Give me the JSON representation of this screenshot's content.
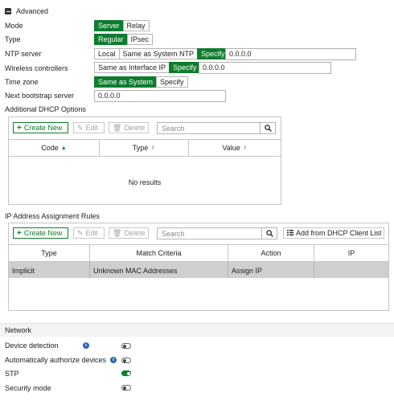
{
  "advanced": {
    "toggle_icon": "minus-square-icon",
    "title": "Advanced",
    "mode": {
      "label": "Mode",
      "options": [
        "Server",
        "Relay"
      ],
      "selected": "Server"
    },
    "type": {
      "label": "Type",
      "options": [
        "Regular",
        "IPsec"
      ],
      "selected": "Regular"
    },
    "ntp": {
      "label": "NTP server",
      "options": [
        "Local",
        "Same as System NTP",
        "Specify"
      ],
      "selected": "Specify",
      "value": "0.0.0.0"
    },
    "wlc": {
      "label": "Wireless controllers",
      "options": [
        "Same as Interface IP",
        "Specify"
      ],
      "selected": "Specify",
      "value": "0.0.0.0"
    },
    "timezone": {
      "label": "Time zone",
      "options": [
        "Same as System",
        "Specify"
      ],
      "selected": "Same as System"
    },
    "bootstrap": {
      "label": "Next bootstrap server",
      "value": "0.0.0.0"
    }
  },
  "dhcp_options": {
    "title": "Additional DHCP Options",
    "create_label": "Create New",
    "edit_label": "Edit",
    "delete_label": "Delete",
    "search_placeholder": "Search",
    "columns": [
      "Code",
      "Type",
      "Value"
    ],
    "empty_text": "No results"
  },
  "ip_rules": {
    "title": "IP Address Assignment Rules",
    "create_label": "Create New",
    "edit_label": "Edit",
    "delete_label": "Delete",
    "search_placeholder": "Search",
    "add_dhcp_label": "Add from DHCP Client List",
    "columns": [
      "Type",
      "Match Criteria",
      "Action",
      "IP"
    ],
    "rows": [
      {
        "type": "Implicit",
        "match": "Unknown MAC Addresses",
        "action": "Assign IP",
        "ip": ""
      }
    ]
  },
  "network": {
    "title": "Network",
    "device_detection": {
      "label": "Device detection",
      "on": false
    },
    "auto_authorize": {
      "label": "Automatically authorize devices",
      "on": false
    },
    "stp": {
      "label": "STP",
      "on": true
    },
    "security_mode": {
      "label": "Security mode",
      "on": false
    }
  },
  "colors": {
    "accent": "#0f7c2e",
    "info": "#2b66b3",
    "row_selected": "#cfcfcf"
  }
}
